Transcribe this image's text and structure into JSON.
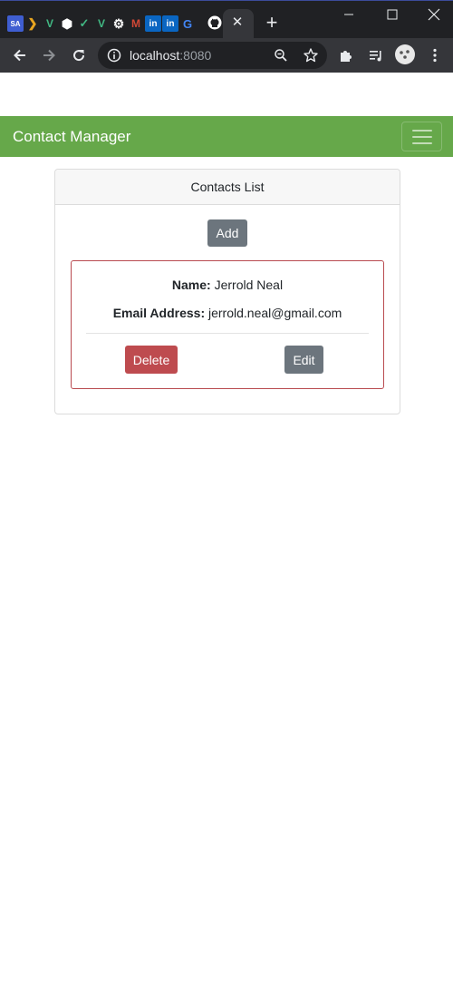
{
  "browser": {
    "tab_icons": [
      "SA",
      "❯",
      "V",
      "⬢",
      "✓",
      "V",
      "⚙",
      "M",
      "in",
      "in",
      "G"
    ],
    "tab_close_glyph": "✕",
    "new_tab_glyph": "+",
    "url_host": "localhost",
    "url_port": ":8080",
    "icons": {
      "back": "arrow-left-icon",
      "forward": "arrow-right-icon",
      "reload": "reload-icon",
      "info": "info-icon",
      "zoom": "zoom-icon",
      "bookmark": "star-icon",
      "extensions": "puzzle-icon",
      "media": "media-list-icon",
      "profile": "avatar-icon",
      "menu": "kebab-menu-icon"
    }
  },
  "navbar": {
    "brand": "Contact Manager",
    "color": "#66a84a"
  },
  "card": {
    "header": "Contacts List",
    "add_label": "Add"
  },
  "contacts": [
    {
      "name_label": "Name:",
      "name": "Jerrold Neal",
      "email_label": "Email Address:",
      "email": "jerrold.neal@gmail.com",
      "delete_label": "Delete",
      "edit_label": "Edit"
    }
  ],
  "colors": {
    "danger": "#be4b4f",
    "secondary": "#6c757d",
    "contact_border": "#b94a50"
  }
}
